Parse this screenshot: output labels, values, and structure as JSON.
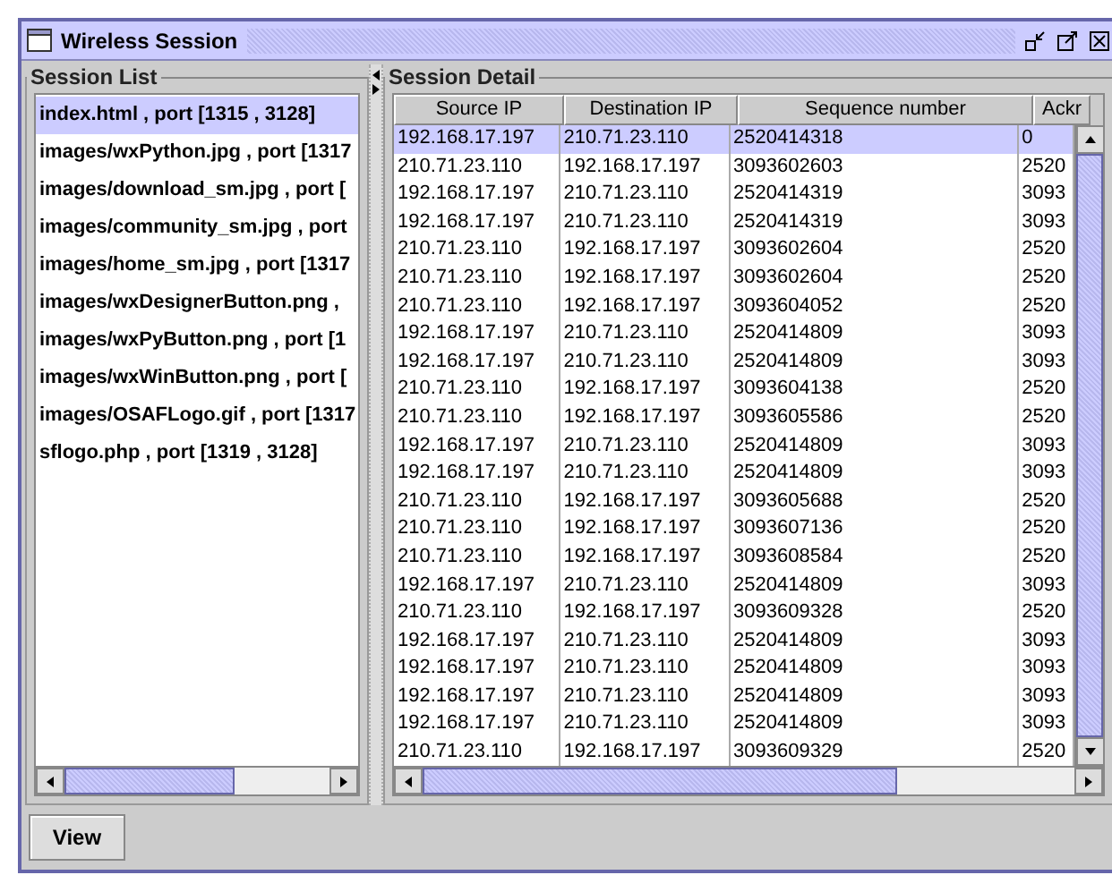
{
  "window": {
    "title": "Wireless Session"
  },
  "session_list": {
    "title": "Session List",
    "items": [
      {
        "label": "index.html , port [1315 , 3128]",
        "selected": true
      },
      {
        "label": "images/wxPython.jpg , port [1317",
        "selected": false
      },
      {
        "label": "images/download_sm.jpg , port [",
        "selected": false
      },
      {
        "label": "images/community_sm.jpg , port",
        "selected": false
      },
      {
        "label": "images/home_sm.jpg , port [1317",
        "selected": false
      },
      {
        "label": "images/wxDesignerButton.png ,",
        "selected": false
      },
      {
        "label": "images/wxPyButton.png , port [1",
        "selected": false
      },
      {
        "label": "images/wxWinButton.png , port [",
        "selected": false
      },
      {
        "label": "images/OSAFLogo.gif , port [1317",
        "selected": false
      },
      {
        "label": "sflogo.php , port [1319 , 3128]",
        "selected": false
      }
    ]
  },
  "session_detail": {
    "title": "Session Detail",
    "columns": [
      "Source IP",
      "Destination IP",
      "Sequence number",
      "Ackr"
    ],
    "rows": [
      {
        "cells": [
          "192.168.17.197",
          "210.71.23.110",
          "2520414318",
          "0"
        ],
        "selected": true
      },
      {
        "cells": [
          "210.71.23.110",
          "192.168.17.197",
          "3093602603",
          "2520"
        ],
        "selected": false
      },
      {
        "cells": [
          "192.168.17.197",
          "210.71.23.110",
          "2520414319",
          "3093"
        ],
        "selected": false
      },
      {
        "cells": [
          "192.168.17.197",
          "210.71.23.110",
          "2520414319",
          "3093"
        ],
        "selected": false
      },
      {
        "cells": [
          "210.71.23.110",
          "192.168.17.197",
          "3093602604",
          "2520"
        ],
        "selected": false
      },
      {
        "cells": [
          "210.71.23.110",
          "192.168.17.197",
          "3093602604",
          "2520"
        ],
        "selected": false
      },
      {
        "cells": [
          "210.71.23.110",
          "192.168.17.197",
          "3093604052",
          "2520"
        ],
        "selected": false
      },
      {
        "cells": [
          "192.168.17.197",
          "210.71.23.110",
          "2520414809",
          "3093"
        ],
        "selected": false
      },
      {
        "cells": [
          "192.168.17.197",
          "210.71.23.110",
          "2520414809",
          "3093"
        ],
        "selected": false
      },
      {
        "cells": [
          "210.71.23.110",
          "192.168.17.197",
          "3093604138",
          "2520"
        ],
        "selected": false
      },
      {
        "cells": [
          "210.71.23.110",
          "192.168.17.197",
          "3093605586",
          "2520"
        ],
        "selected": false
      },
      {
        "cells": [
          "192.168.17.197",
          "210.71.23.110",
          "2520414809",
          "3093"
        ],
        "selected": false
      },
      {
        "cells": [
          "192.168.17.197",
          "210.71.23.110",
          "2520414809",
          "3093"
        ],
        "selected": false
      },
      {
        "cells": [
          "210.71.23.110",
          "192.168.17.197",
          "3093605688",
          "2520"
        ],
        "selected": false
      },
      {
        "cells": [
          "210.71.23.110",
          "192.168.17.197",
          "3093607136",
          "2520"
        ],
        "selected": false
      },
      {
        "cells": [
          "210.71.23.110",
          "192.168.17.197",
          "3093608584",
          "2520"
        ],
        "selected": false
      },
      {
        "cells": [
          "192.168.17.197",
          "210.71.23.110",
          "2520414809",
          "3093"
        ],
        "selected": false
      },
      {
        "cells": [
          "210.71.23.110",
          "192.168.17.197",
          "3093609328",
          "2520"
        ],
        "selected": false
      },
      {
        "cells": [
          "192.168.17.197",
          "210.71.23.110",
          "2520414809",
          "3093"
        ],
        "selected": false
      },
      {
        "cells": [
          "192.168.17.197",
          "210.71.23.110",
          "2520414809",
          "3093"
        ],
        "selected": false
      },
      {
        "cells": [
          "192.168.17.197",
          "210.71.23.110",
          "2520414809",
          "3093"
        ],
        "selected": false
      },
      {
        "cells": [
          "192.168.17.197",
          "210.71.23.110",
          "2520414809",
          "3093"
        ],
        "selected": false
      },
      {
        "cells": [
          "210.71.23.110",
          "192.168.17.197",
          "3093609329",
          "2520"
        ],
        "selected": false
      }
    ]
  },
  "buttons": [
    "View"
  ]
}
